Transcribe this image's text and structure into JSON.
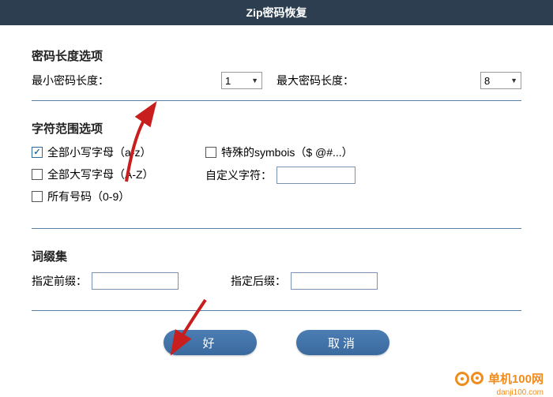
{
  "title": "Zip密码恢复",
  "length": {
    "section_title": "密码长度选项",
    "min_label": "最小密码长度：",
    "min_value": "1",
    "max_label": "最大密码长度：",
    "max_value": "8"
  },
  "charset": {
    "section_title": "字符范围选项",
    "lower": {
      "label": "全部小写字母（a-z）",
      "checked": true
    },
    "upper": {
      "label": "全部大写字母（A-Z）",
      "checked": false
    },
    "digits": {
      "label": "所有号码（0-9）",
      "checked": false
    },
    "symbols": {
      "label": "特殊的symbois（$ @#...）",
      "checked": false
    },
    "custom_label": "自定义字符：",
    "custom_value": ""
  },
  "affix": {
    "section_title": "词缀集",
    "prefix_label": "指定前缀：",
    "prefix_value": "",
    "suffix_label": "指定后缀：",
    "suffix_value": ""
  },
  "buttons": {
    "ok": "好",
    "cancel": "取消"
  },
  "branding": {
    "name": "单机100网",
    "url": "danji100.com"
  }
}
